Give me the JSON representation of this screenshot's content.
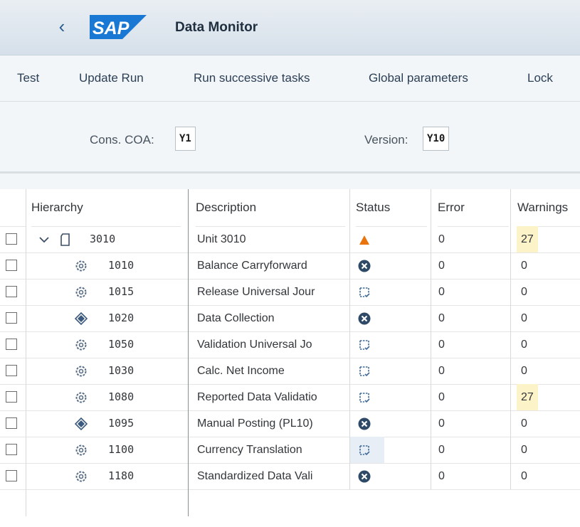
{
  "header": {
    "title": "Data Monitor",
    "logo_text": "SAP"
  },
  "toolbar": {
    "items": [
      "Test",
      "Update Run",
      "Run successive tasks",
      "Global parameters",
      "Lock"
    ]
  },
  "selection": {
    "coa_label": "Cons. COA:",
    "coa_value": "Y1",
    "version_label": "Version:",
    "version_value": "Y10"
  },
  "table": {
    "columns": [
      "Hierarchy",
      "Description",
      "Status",
      "Error",
      "Warnings"
    ],
    "rows": [
      {
        "code": "3010",
        "desc": "Unit 3010",
        "status": "warning",
        "error": "0",
        "warnings": "27",
        "icon": "folder",
        "expanded": true
      },
      {
        "code": "1010",
        "desc": "Balance Carryforward",
        "status": "error",
        "error": "0",
        "warnings": "0",
        "icon": "gear"
      },
      {
        "code": "1015",
        "desc": "Release Universal Jour",
        "status": "pending",
        "error": "0",
        "warnings": "0",
        "icon": "gear"
      },
      {
        "code": "1020",
        "desc": "Data Collection",
        "status": "error",
        "error": "0",
        "warnings": "0",
        "icon": "diamond"
      },
      {
        "code": "1050",
        "desc": "Validation Universal Jo",
        "status": "pending",
        "error": "0",
        "warnings": "0",
        "icon": "gear"
      },
      {
        "code": "1030",
        "desc": "Calc. Net Income",
        "status": "pending",
        "error": "0",
        "warnings": "0",
        "icon": "gear"
      },
      {
        "code": "1080",
        "desc": "Reported Data Validatio",
        "status": "pending",
        "error": "0",
        "warnings": "27",
        "icon": "gear"
      },
      {
        "code": "1095",
        "desc": "Manual Posting (PL10)",
        "status": "error",
        "error": "0",
        "warnings": "0",
        "icon": "diamond"
      },
      {
        "code": "1100",
        "desc": "Currency Translation",
        "status": "pending",
        "error": "0",
        "warnings": "0",
        "icon": "gear",
        "selected": true
      },
      {
        "code": "1180",
        "desc": "Standardized Data Vali",
        "status": "error",
        "error": "0",
        "warnings": "0",
        "icon": "gear"
      }
    ]
  },
  "colors": {
    "warning": "#e9730c",
    "error": "#2f4a66",
    "pending": "#3d6a9a",
    "warn_highlight": "#fdf3c9"
  }
}
